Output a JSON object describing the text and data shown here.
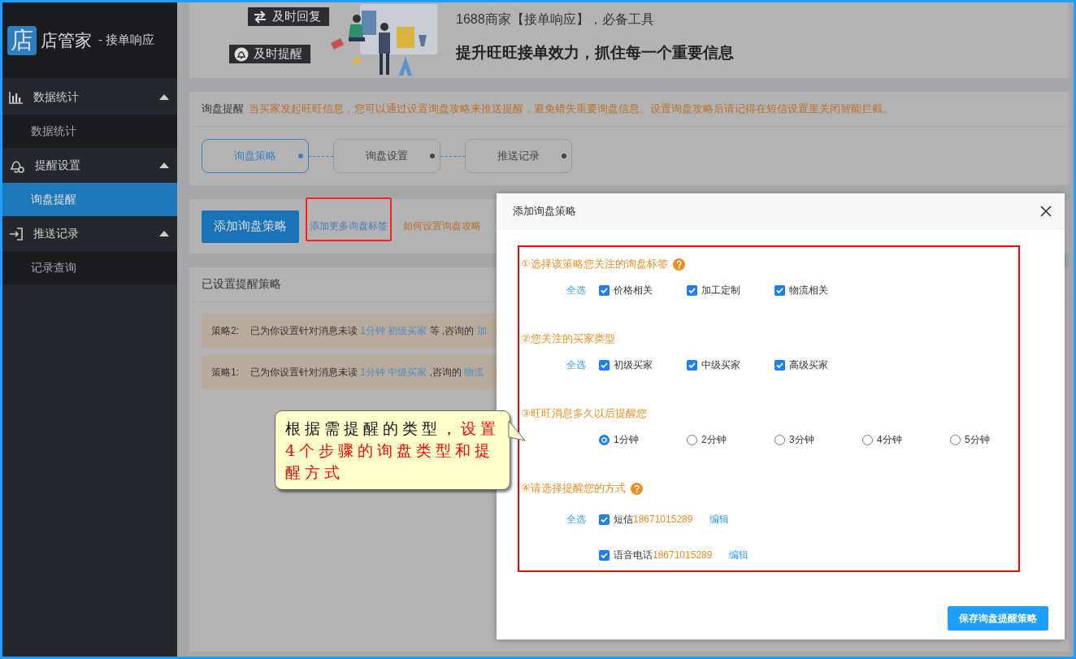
{
  "sidebar": {
    "logo": {
      "glyph": "店",
      "name": "店管家",
      "subtitle": "- 接单响应"
    },
    "groups": [
      {
        "label": "数据统计",
        "expanded": true,
        "children": [
          {
            "label": "数据统计",
            "selected": false
          }
        ]
      },
      {
        "label": "提醒设置",
        "expanded": true,
        "children": [
          {
            "label": "询盘提醒",
            "selected": true
          }
        ]
      },
      {
        "label": "推送记录",
        "expanded": true,
        "children": [
          {
            "label": "记录查询",
            "selected": false
          }
        ]
      }
    ]
  },
  "banner": {
    "tags": [
      "及时回复",
      "及时提醒"
    ],
    "subtitle": "1688商家【接单响应】，必备工具",
    "headline": "提升旺旺接单效力，抓住每一个重要信息"
  },
  "notice": {
    "label": "询盘提醒",
    "text": "当买家发起旺旺信息，您可以通过设置询盘攻略来推送提醒，避免错失重要询盘信息。设置询盘攻略后请记得在短信设置里关闭智能拦截。"
  },
  "steps": [
    {
      "label": "询盘策略",
      "selected": true
    },
    {
      "label": "询盘设置",
      "selected": false
    },
    {
      "label": "推送记录",
      "selected": false
    }
  ],
  "actions": {
    "primary": "添加询盘策略",
    "links": [
      {
        "text": "添加更多询盘标签",
        "kind": "tags",
        "highlighted": true
      },
      {
        "text": "如何设置询盘攻略",
        "kind": "guide",
        "highlighted": false
      }
    ]
  },
  "policies": {
    "title": "已设置提醒策略",
    "rows": [
      {
        "label": "策略2:",
        "segments": [
          {
            "text": "已为你设置针对消息未读",
            "kind": "text"
          },
          {
            "text": "1分钟",
            "kind": "link"
          },
          {
            "text": "初级买家",
            "kind": "link"
          },
          {
            "text": "等 ,咨询的",
            "kind": "text"
          },
          {
            "text": "加",
            "kind": "link"
          }
        ]
      },
      {
        "label": "策略1:",
        "segments": [
          {
            "text": "已为你设置针对消息未读",
            "kind": "text"
          },
          {
            "text": "1分钟",
            "kind": "link"
          },
          {
            "text": "中级买家",
            "kind": "link"
          },
          {
            "text": ",咨询的",
            "kind": "text"
          },
          {
            "text": "物流",
            "kind": "link"
          }
        ]
      }
    ]
  },
  "callout": {
    "segments": [
      {
        "text": "根据需提醒的类型，",
        "emphasis": false
      },
      {
        "text": "设置4个步骤的询盘类型和提醒方式",
        "emphasis": true
      }
    ]
  },
  "dialog": {
    "title": "添加询盘策略",
    "highlighted": true,
    "save": "保存询盘提醒策略",
    "sections": [
      {
        "title": "①选择该策略您关注的询盘标签",
        "help": true,
        "rows": [
          {
            "select_all": "全选",
            "options": [
              {
                "kind": "checkbox",
                "label": "价格相关",
                "checked": true
              },
              {
                "kind": "checkbox",
                "label": "加工定制",
                "checked": true
              },
              {
                "kind": "checkbox",
                "label": "物流相关",
                "checked": true
              }
            ]
          }
        ]
      },
      {
        "title": "②您关注的买家类型",
        "help": false,
        "rows": [
          {
            "select_all": "全选",
            "options": [
              {
                "kind": "checkbox",
                "label": "初级买家",
                "checked": true
              },
              {
                "kind": "checkbox",
                "label": "中级买家",
                "checked": true
              },
              {
                "kind": "checkbox",
                "label": "高级买家",
                "checked": true
              }
            ]
          }
        ]
      },
      {
        "title": "③旺旺消息多久以后提醒您",
        "help": false,
        "rows": [
          {
            "options": [
              {
                "kind": "radio",
                "label": "1分钟",
                "selected": true
              },
              {
                "kind": "radio",
                "label": "2分钟",
                "selected": false
              },
              {
                "kind": "radio",
                "label": "3分钟",
                "selected": false
              },
              {
                "kind": "radio",
                "label": "4分钟",
                "selected": false
              },
              {
                "kind": "radio",
                "label": "5分钟",
                "selected": false
              }
            ]
          }
        ]
      },
      {
        "title": "④请选择提醒您的方式",
        "help": true,
        "rows": [
          {
            "select_all": "全选",
            "options": [
              {
                "kind": "contact",
                "label": "短信",
                "phone": "18671015289",
                "edit": "编辑",
                "checked": true
              }
            ]
          },
          {
            "options": [
              {
                "kind": "contact",
                "label": "语音电话",
                "phone": "18671015289",
                "edit": "编辑",
                "checked": true
              }
            ]
          }
        ]
      }
    ]
  }
}
